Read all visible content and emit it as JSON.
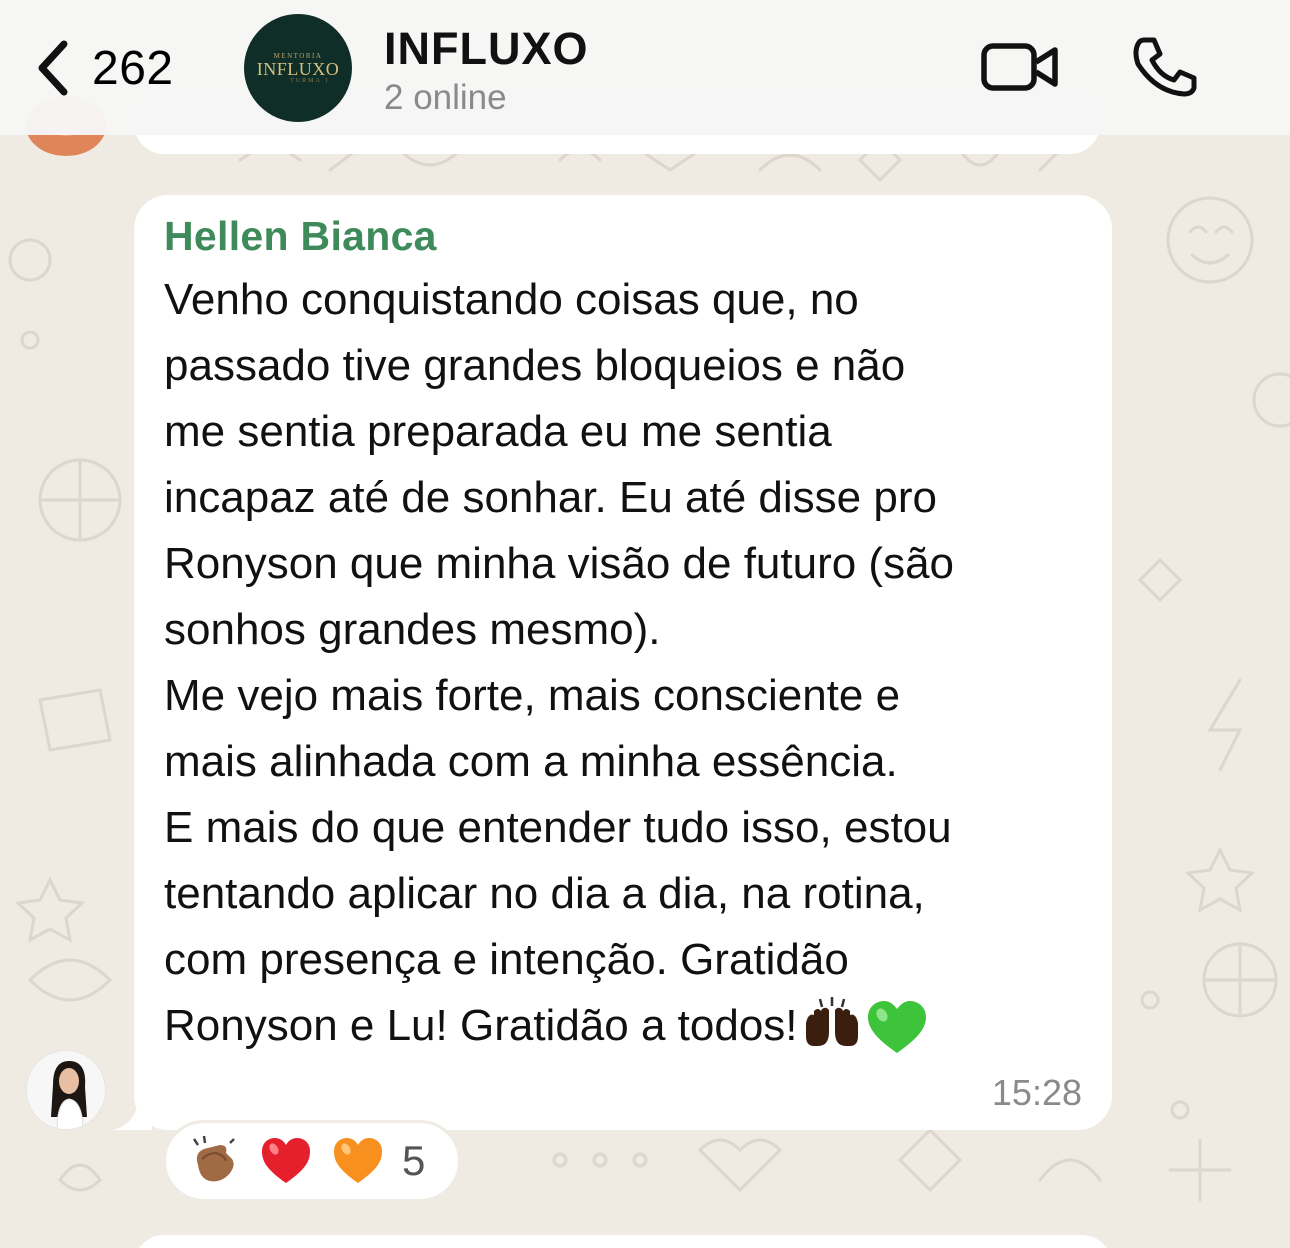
{
  "header": {
    "back_count": "262",
    "group_name": "INFLUXO",
    "group_status": "2 online",
    "avatar_logo_sub": "MENTORIA",
    "avatar_logo_text": "INFLUXO",
    "avatar_logo_sub2": "TURMA 1",
    "icons": [
      "chevron-left-icon",
      "video-icon",
      "phone-icon"
    ]
  },
  "message": {
    "sender": "Hellen Bianca",
    "lines": [
      "Venho conquistando coisas que, no",
      "passado tive grandes bloqueios e não",
      "me sentia preparada eu me sentia",
      "incapaz até de sonhar. Eu até disse pro",
      "Ronyson que minha visão de futuro (são",
      "sonhos grandes mesmo).",
      "Me vejo mais forte, mais consciente e",
      "mais alinhada com a minha essência.",
      "E mais do que entender tudo isso, estou",
      "tentando aplicar no dia a dia, na rotina,",
      "com presença e intenção. Gratidão",
      "Ronyson e Lu! Gratidão a todos!"
    ],
    "trailing_emojis": [
      "raising-hands-emoji",
      "green-heart-emoji"
    ],
    "time": "15:28"
  },
  "reactions": {
    "emojis": [
      "clapping-hands-emoji",
      "red-heart-emoji",
      "orange-heart-emoji"
    ],
    "count": "5"
  },
  "colors": {
    "sender_name": "#3f8a5a",
    "chat_background": "#efeae2",
    "bubble": "#ffffff",
    "group_avatar_bg": "#0f2e27"
  }
}
